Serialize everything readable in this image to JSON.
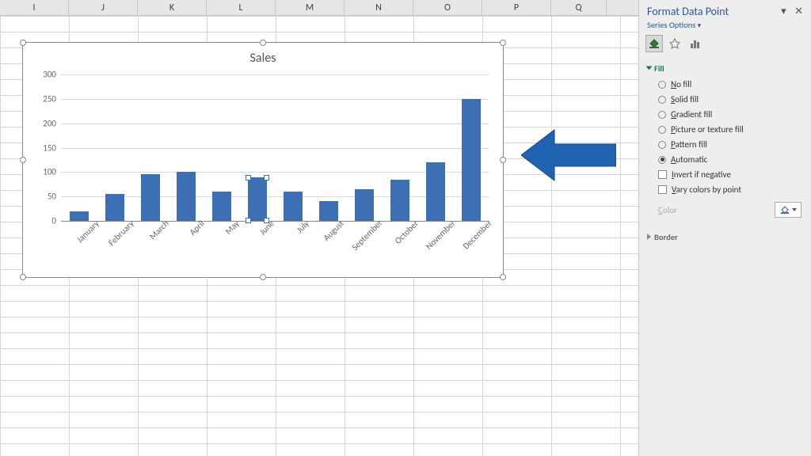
{
  "columns": [
    "I",
    "J",
    "K",
    "L",
    "M",
    "N",
    "O",
    "P",
    "Q"
  ],
  "pane": {
    "title": "Format Data Point",
    "subtitle": "Series Options",
    "section_fill": "Fill",
    "no_fill_pre": "N",
    "no_fill_post": "o fill",
    "solid_fill_pre": "S",
    "solid_fill_post": "olid fill",
    "gradient_fill_pre": "G",
    "gradient_fill_post": "radient fill",
    "picture_fill_pre": "P",
    "picture_fill_post": "icture or texture fill",
    "pattern_fill_pre": "P",
    "pattern_fill_post": "attern fill",
    "automatic_pre": "A",
    "automatic_post": "utomatic",
    "invert_pre": "I",
    "invert_post": "nvert if negative",
    "vary_pre": "V",
    "vary_post": "ary colors by point",
    "color_label_pre": "C",
    "color_label_post": "olor",
    "section_border": "Border"
  },
  "chart_data": {
    "type": "bar",
    "title": "Sales",
    "categories": [
      "January",
      "February",
      "March",
      "April",
      "May",
      "June",
      "July",
      "August",
      "September",
      "October",
      "November",
      "December"
    ],
    "values": [
      20,
      55,
      95,
      100,
      60,
      90,
      60,
      40,
      65,
      85,
      120,
      250
    ],
    "ylabel": "",
    "xlabel": "",
    "ylim": [
      0,
      300
    ],
    "y_ticks": [
      0,
      50,
      100,
      150,
      200,
      250,
      300
    ],
    "selected_index": 5,
    "bar_color": "#3d6fb4"
  }
}
